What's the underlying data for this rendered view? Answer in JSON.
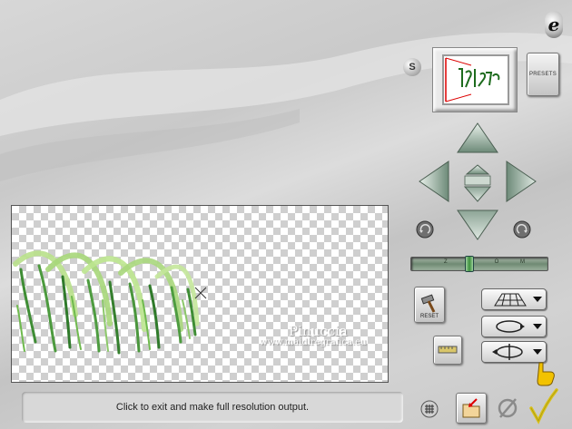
{
  "status": {
    "message": "Click to exit and make full resolution output."
  },
  "controls": {
    "s_label": "S",
    "presets_label": "PRESETS",
    "logo_glyph": "e",
    "reset_label": "RESET",
    "zoom_letters": [
      "Z",
      "O",
      "O",
      "M"
    ],
    "zoom_level": 0.42
  },
  "watermark": {
    "name": "Pinuccia",
    "url": "www.maidiregrafica.eu"
  },
  "icons": {
    "move": [
      "arrow-up-icon",
      "arrow-down-icon",
      "arrow-left-icon",
      "arrow-right-icon",
      "small-up-icon",
      "small-down-icon"
    ],
    "rotate": [
      "rotate-left-icon",
      "rotate-right-icon"
    ],
    "tools": [
      "perspective-grid-icon",
      "rotate-loop-icon",
      "flip-icon",
      "grid-icon",
      "export-icon",
      "cancel-icon",
      "apply-check-icon",
      "help-hand-icon",
      "tape-icon"
    ]
  },
  "colors": {
    "accent_green": "#4a8f4a",
    "check_yellow": "#d9c21a",
    "hand_yellow": "#f2c200"
  }
}
